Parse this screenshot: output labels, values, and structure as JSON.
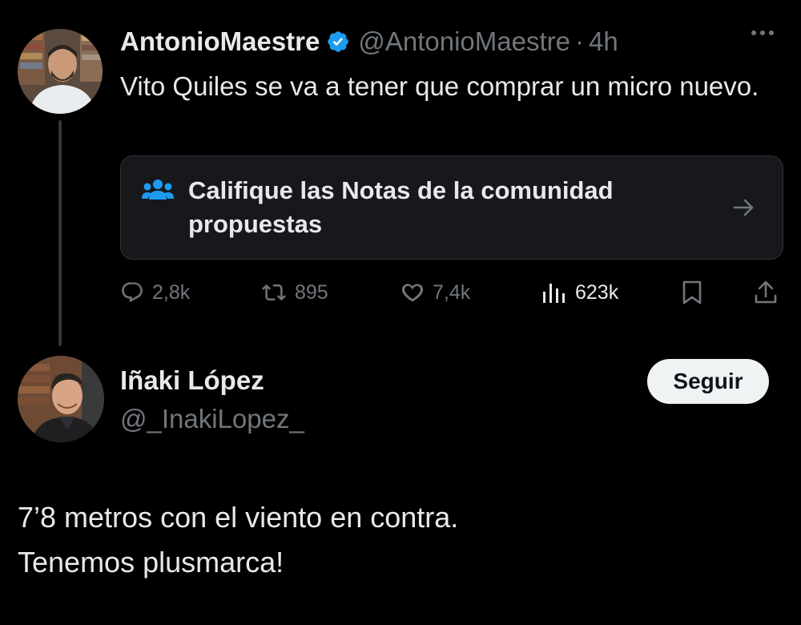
{
  "tweet": {
    "display_name": "AntonioMaestre",
    "handle": "@AntonioMaestre",
    "separator": "·",
    "time": "4h",
    "text": "Vito Quiles se va a tener que comprar un micro nuevo.",
    "community_notes_prompt": "Califique las Notas de la comunidad propuestas",
    "stats": {
      "replies": "2,8k",
      "reposts": "895",
      "likes": "7,4k",
      "views": "623k"
    }
  },
  "reply": {
    "display_name": "Iñaki López",
    "handle": "@_InakiLopez_",
    "follow_label": "Seguir",
    "lines": [
      "7’8 metros con el viento en contra.",
      "Tenemos plusmarca!"
    ]
  },
  "colors": {
    "background": "#000000",
    "text": "#e7e9ea",
    "secondary": "#71767b",
    "accent": "#1d9bf0",
    "card": "#16181c",
    "follow_button": "#eff3f4"
  },
  "icons": {
    "verified": "verified-badge-icon",
    "more": "more-horizontal-icon",
    "community": "people-icon",
    "arrow": "arrow-right-icon",
    "reply": "reply-icon",
    "repost": "repost-icon",
    "like": "heart-icon",
    "views": "views-chart-icon",
    "bookmark": "bookmark-icon",
    "share": "share-icon"
  }
}
